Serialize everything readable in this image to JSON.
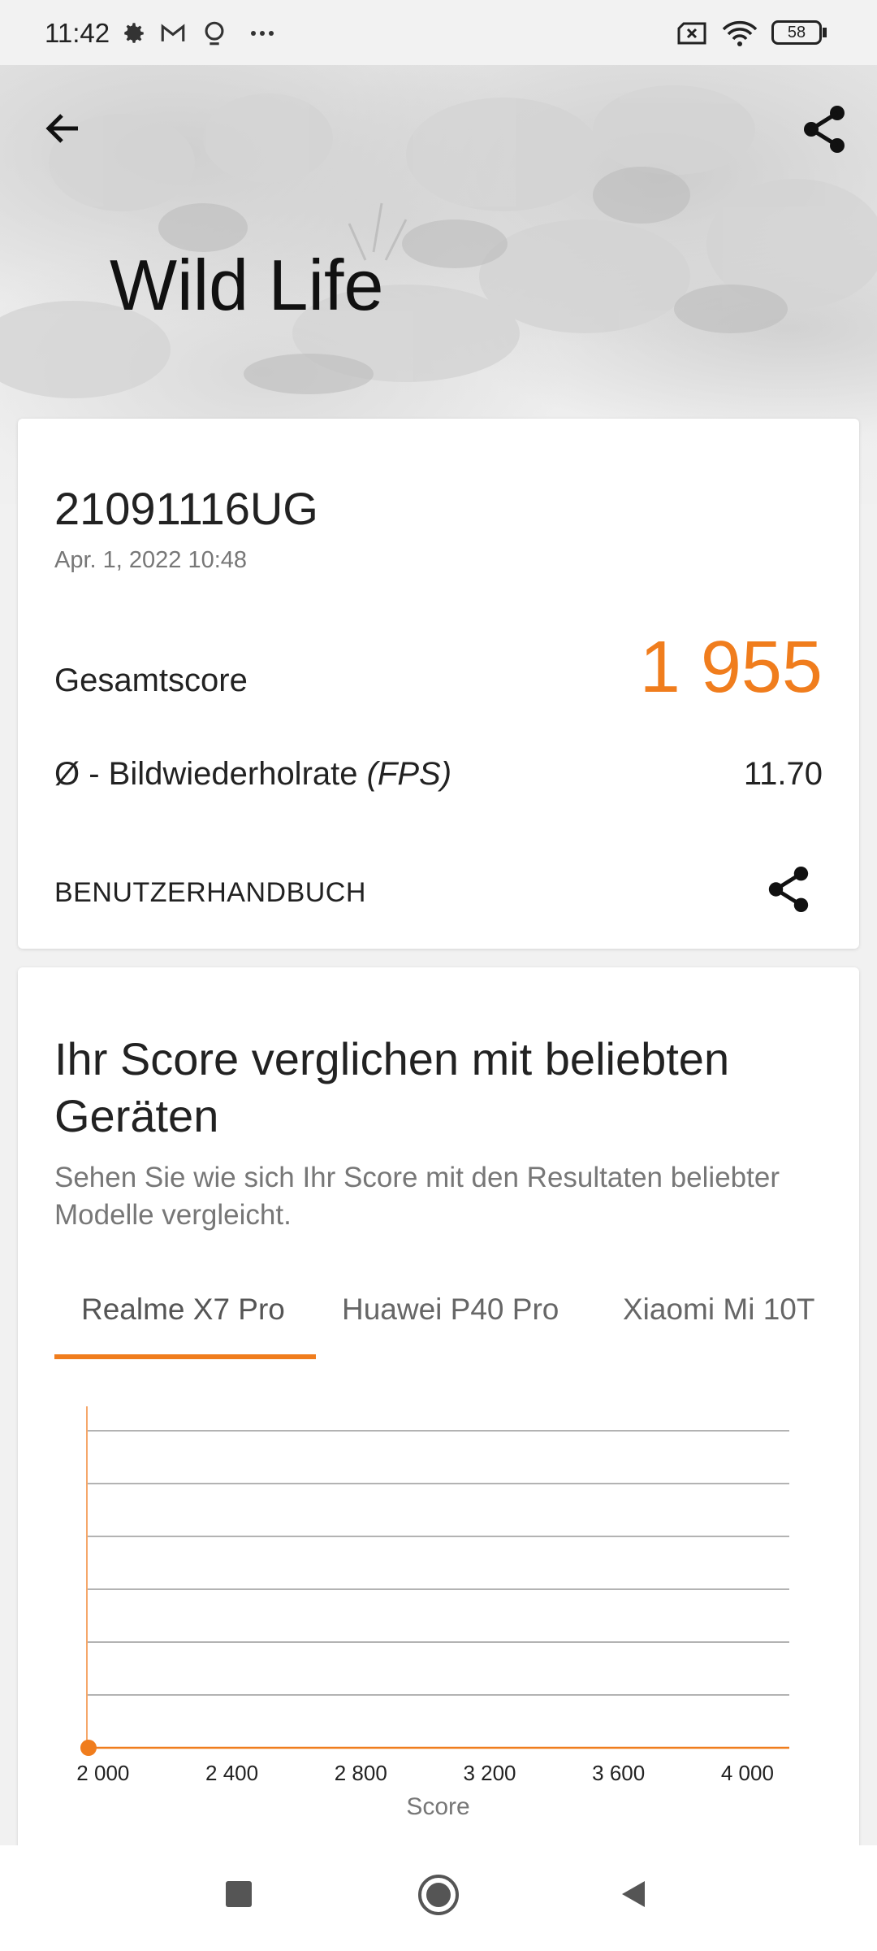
{
  "status": {
    "time": "11:42",
    "battery": "58"
  },
  "hero": {
    "title": "Wild Life"
  },
  "result": {
    "device": "21091116UG",
    "date": "Apr. 1, 2022 10:48",
    "score_label": "Gesamtscore",
    "score_value": "1 955",
    "fps_prefix": "Ø - Bildwiederholrate ",
    "fps_unit": "(FPS)",
    "fps_value": "11.70",
    "manual_label": "BENUTZERHANDBUCH"
  },
  "compare": {
    "title": "Ihr Score verglichen mit beliebten Geräten",
    "subtitle": "Sehen Sie wie sich Ihr Score mit den Resultaten beliebter Modelle vergleicht.",
    "tabs": [
      "Realme X7 Pro",
      "Huawei P40 Pro",
      "Xiaomi Mi 10T"
    ],
    "active_tab": "Realme X7 Pro"
  },
  "chart_data": {
    "type": "area",
    "xlabel": "Score",
    "x_ticks": [
      2000,
      2400,
      2800,
      3200,
      3600,
      4000
    ],
    "x_tick_labels": [
      "2 000",
      "2 400",
      "2 800",
      "3 200",
      "3 600",
      "4 000"
    ],
    "xlim": [
      1950,
      4130
    ],
    "ylim": [
      0,
      6
    ],
    "grid": true,
    "marker_x": 1955,
    "x": [
      1950,
      1970,
      1990,
      2010,
      2030,
      2050,
      2070,
      2090,
      2110,
      2130,
      2150,
      2170,
      2190,
      2210,
      2230,
      2250,
      2270,
      2290,
      2310,
      2330,
      2350,
      2370,
      2390,
      2410,
      2430,
      2450,
      2470,
      2490,
      2510,
      2530,
      2550,
      2570,
      2590,
      2610,
      2630,
      2650,
      2670,
      2690,
      2710,
      2730,
      2750,
      2770,
      2790,
      2810,
      2830,
      2850,
      2870,
      2890,
      2910,
      2930,
      2950,
      2970,
      2990,
      3010,
      3030,
      3050,
      3070,
      3090,
      3110,
      3130,
      3150,
      3170,
      3190,
      3210,
      3230,
      3250,
      3270,
      3290,
      3310,
      3330,
      3350,
      3370,
      3390,
      3410,
      3430,
      3450,
      3470,
      3490,
      3510,
      3530,
      3550,
      3570,
      3590,
      3610,
      3630,
      3650,
      3670,
      3690,
      3710,
      3730,
      3750,
      3770,
      3790,
      3810,
      3830,
      3850,
      3870,
      3890,
      3910,
      3930,
      3950,
      3970,
      3990,
      4010,
      4030,
      4050,
      4070,
      4090,
      4110
    ],
    "values": [
      0,
      0,
      0,
      0,
      0,
      0,
      0,
      0,
      0,
      0,
      0,
      0,
      0,
      0,
      0,
      0,
      0,
      0,
      0,
      0,
      0,
      0,
      0,
      0,
      0,
      0,
      0,
      0,
      0,
      0,
      0,
      0,
      0,
      0,
      0,
      0,
      0,
      0,
      0,
      0,
      0,
      0,
      0,
      0,
      0,
      0,
      0,
      0,
      0,
      0,
      0,
      0,
      0,
      0,
      0,
      0,
      0,
      0,
      0,
      0,
      0,
      0,
      0,
      0,
      0,
      0,
      0,
      0,
      0,
      0,
      0,
      0,
      0,
      0,
      0,
      0,
      0,
      0,
      0,
      0,
      0,
      0,
      0,
      0,
      0,
      0,
      0,
      0,
      0,
      0,
      0,
      0,
      0,
      0,
      0,
      0,
      0,
      0,
      0,
      0,
      0,
      0,
      0,
      0,
      0,
      0,
      0,
      0,
      0
    ]
  },
  "icons": {
    "back": "arrow-left-icon",
    "share": "share-icon",
    "nav_recents": "square-icon",
    "nav_home": "circle-icon",
    "nav_back": "triangle-back-icon"
  },
  "colors": {
    "accent": "#f07d1d",
    "fill": "#fdd1ab"
  }
}
